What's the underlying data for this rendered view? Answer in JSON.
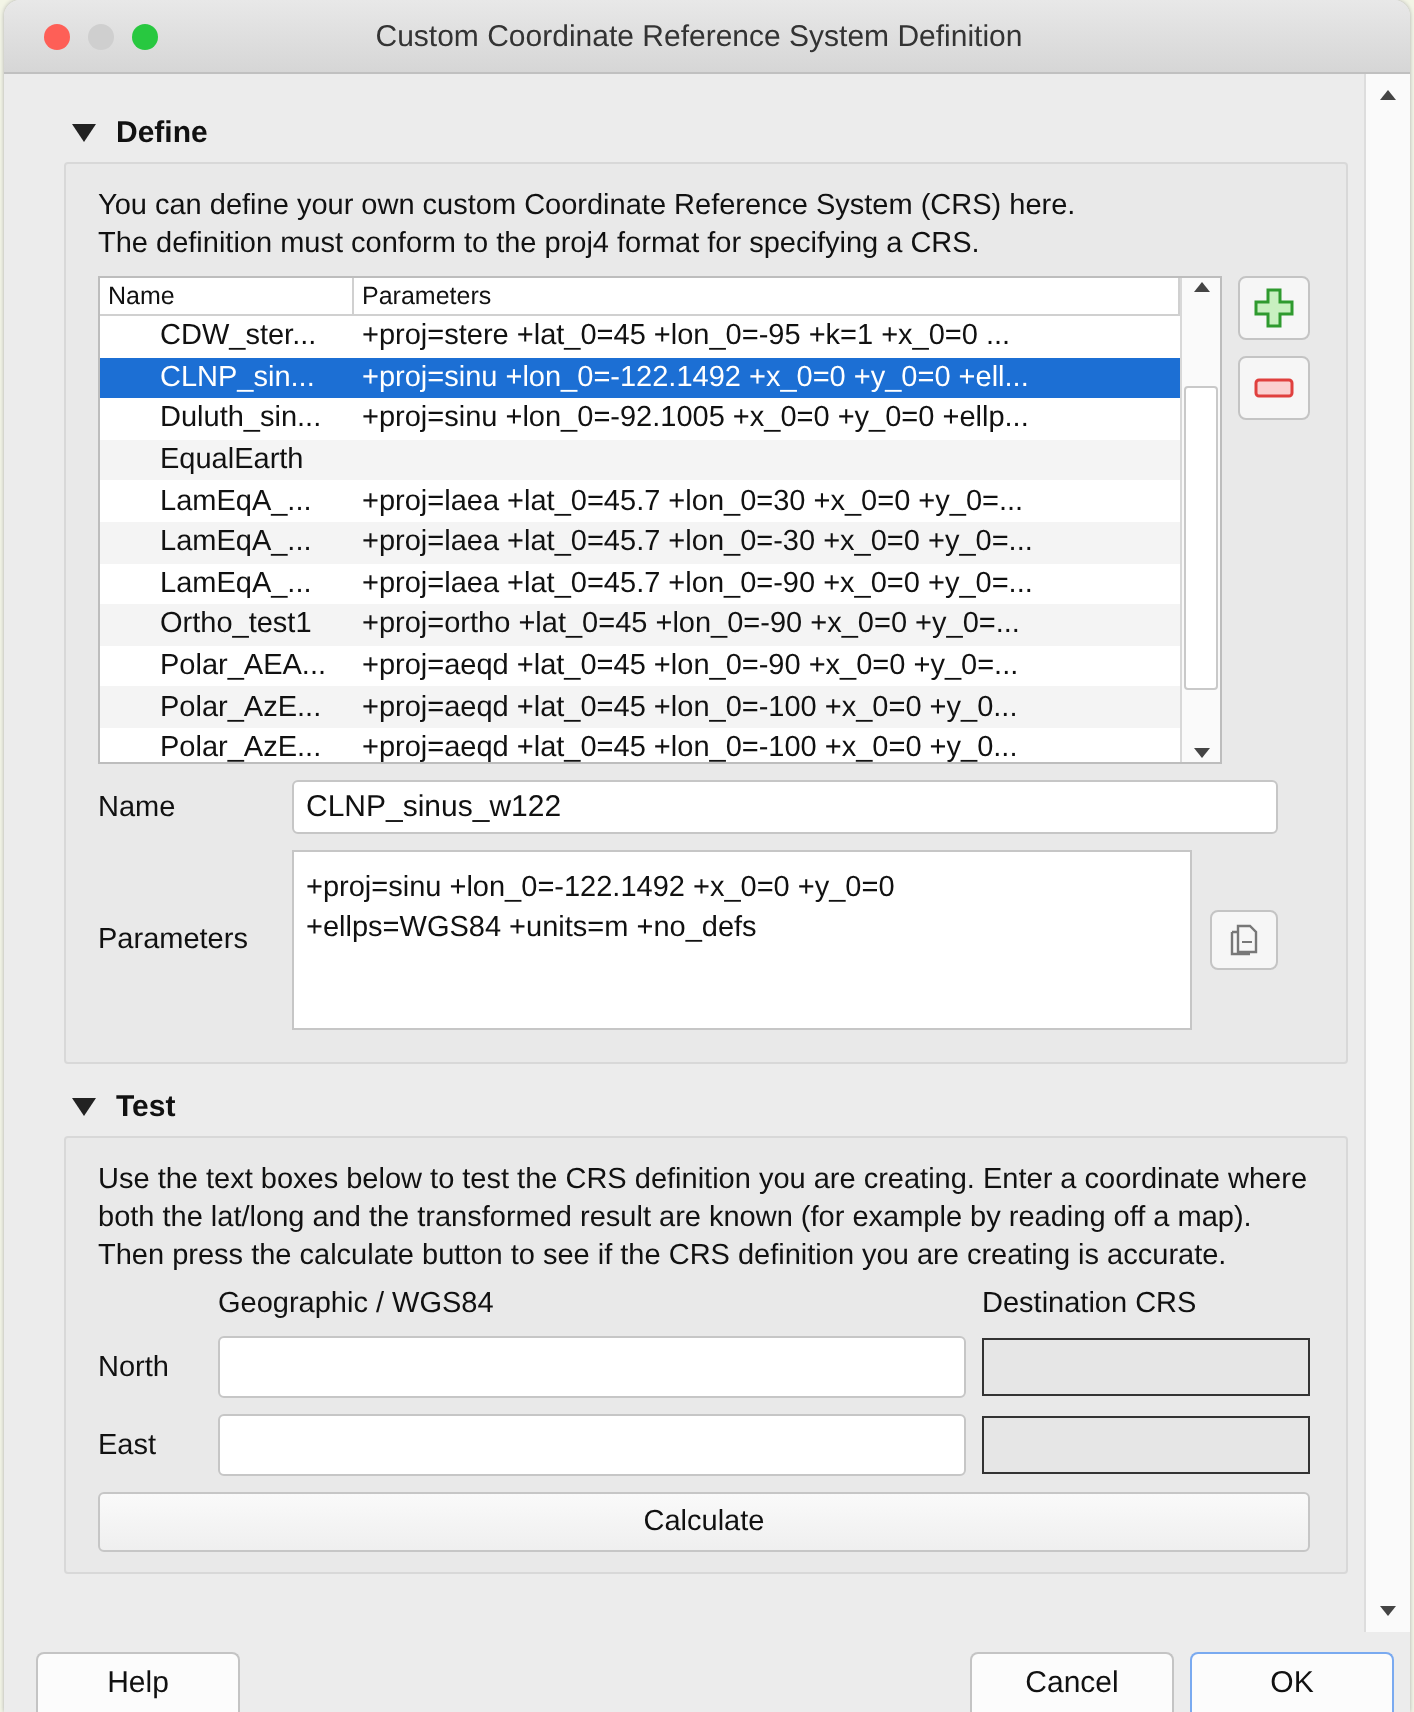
{
  "window": {
    "title": "Custom Coordinate Reference System Definition"
  },
  "define": {
    "title": "Define",
    "expanded": true,
    "intro": "You can define your own custom Coordinate Reference System (CRS) here.\nThe definition must conform to the proj4 format for specifying a CRS.",
    "table": {
      "columns": [
        "Name",
        "Parameters"
      ],
      "rows": [
        {
          "name": "CDW_ster...",
          "parameters": "+proj=stere +lat_0=45 +lon_0=-95 +k=1 +x_0=0 ...",
          "selected": false
        },
        {
          "name": "CLNP_sin...",
          "parameters": "+proj=sinu +lon_0=-122.1492 +x_0=0 +y_0=0 +ell...",
          "selected": true
        },
        {
          "name": "Duluth_sin...",
          "parameters": "+proj=sinu +lon_0=-92.1005 +x_0=0 +y_0=0 +ellp...",
          "selected": false
        },
        {
          "name": "EqualEarth",
          "selected": false
        },
        {
          "name": "LamEqA_...",
          "parameters": "+proj=laea +lat_0=45.7 +lon_0=30 +x_0=0 +y_0=...",
          "selected": false
        },
        {
          "name": "LamEqA_...",
          "parameters": "+proj=laea +lat_0=45.7 +lon_0=-30 +x_0=0 +y_0=...",
          "selected": false
        },
        {
          "name": "LamEqA_...",
          "parameters": "+proj=laea +lat_0=45.7 +lon_0=-90 +x_0=0 +y_0=...",
          "selected": false
        },
        {
          "name": "Ortho_test1",
          "parameters": "+proj=ortho +lat_0=45 +lon_0=-90 +x_0=0 +y_0=...",
          "selected": false
        },
        {
          "name": "Polar_AEA...",
          "parameters": "+proj=aeqd +lat_0=45 +lon_0=-90 +x_0=0 +y_0=...",
          "selected": false
        },
        {
          "name": "Polar_AzE...",
          "parameters": "+proj=aeqd +lat_0=45 +lon_0=-100 +x_0=0 +y_0...",
          "selected": false
        },
        {
          "name": "Polar_AzE...",
          "parameters": "+proj=aeqd +lat_0=45 +lon_0=-100 +x_0=0 +y_0...",
          "selected": false
        }
      ]
    },
    "name_label": "Name",
    "name_value": "CLNP_sinus_w122",
    "parameters_label": "Parameters",
    "parameters_value": "+proj=sinu +lon_0=-122.1492 +x_0=0 +y_0=0\n+ellps=WGS84 +units=m +no_defs"
  },
  "test": {
    "title": "Test",
    "expanded": true,
    "intro": "Use the text boxes below to test the CRS definition you are creating. Enter a coordinate where both the lat/long and the transformed result are known (for example by reading off a map). Then press the calculate button to see if the CRS definition you are creating is accurate.",
    "geographic_heading": "Geographic / WGS84",
    "destination_heading": "Destination CRS",
    "rows": [
      {
        "label": "North"
      },
      {
        "label": "East"
      }
    ],
    "calculate_button": "Calculate"
  },
  "buttons": [
    "Help",
    "Cancel",
    "OK"
  ]
}
